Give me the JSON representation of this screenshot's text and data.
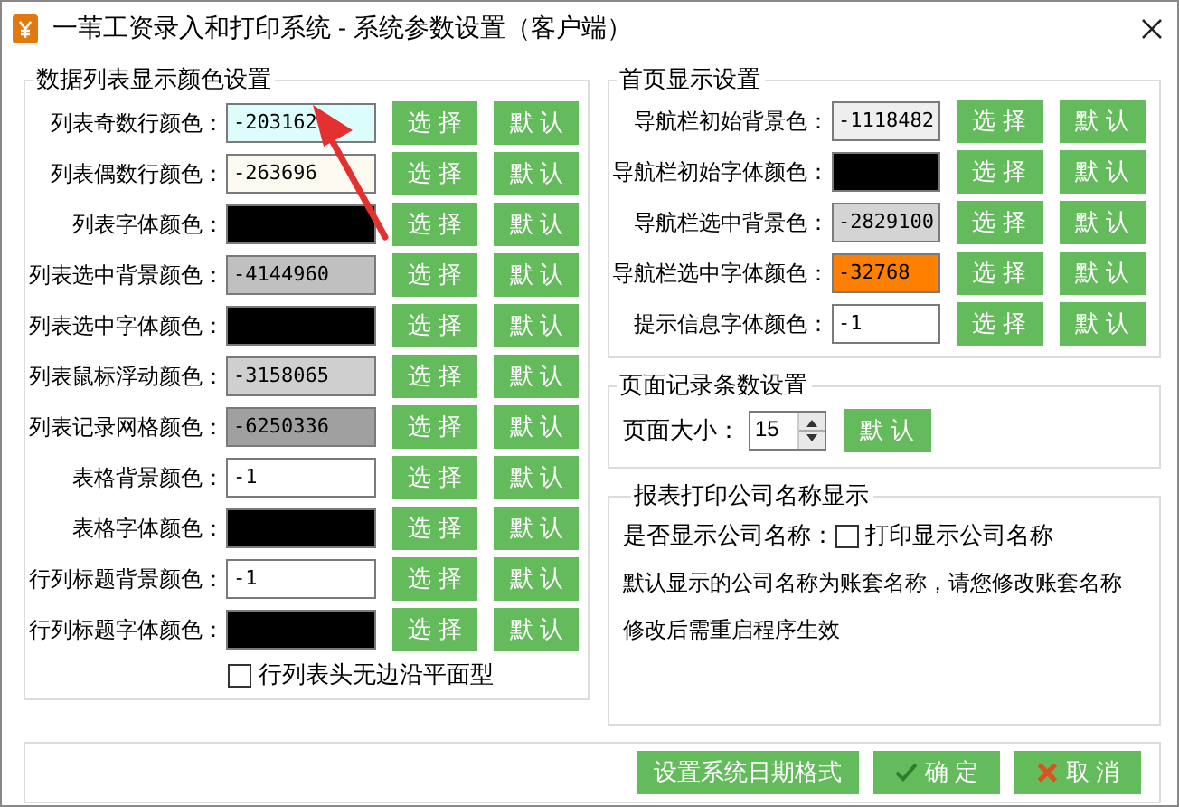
{
  "window": {
    "title": "一苇工资录入和打印系统 - 系统参数设置（客户端）"
  },
  "list_colors": {
    "title": "数据列表显示颜色设置",
    "rows": [
      {
        "label": "列表奇数行颜色：",
        "value": "-203162",
        "color": "#dcfdfb",
        "buttons": [
          "选 择",
          "默 认"
        ]
      },
      {
        "label": "列表偶数行颜色：",
        "value": "-263696",
        "color": "#fbf9f0",
        "buttons": [
          "选 择",
          "默 认"
        ]
      },
      {
        "label": "列表字体颜色：",
        "color": "#000000",
        "buttons": [
          "选 择",
          "默 认"
        ]
      },
      {
        "label": "列表选中背景颜色：",
        "value": "-4144960",
        "color": "#c0c0c0",
        "buttons": [
          "选 择",
          "默 认"
        ]
      },
      {
        "label": "列表选中字体颜色：",
        "color": "#000000",
        "buttons": [
          "选 择",
          "默 认"
        ]
      },
      {
        "label": "列表鼠标浮动颜色：",
        "value": "-3158065",
        "color": "#cfcfcf",
        "buttons": [
          "选 择",
          "默 认"
        ]
      },
      {
        "label": "列表记录网格颜色：",
        "value": "-6250336",
        "color": "#a0a0a0",
        "buttons": [
          "选 择",
          "默 认"
        ]
      },
      {
        "label": "表格背景颜色：",
        "value": "-1",
        "color": "#ffffff",
        "buttons": [
          "选 择",
          "默 认"
        ]
      },
      {
        "label": "表格字体颜色：",
        "color": "#000000",
        "buttons": [
          "选 择",
          "默 认"
        ]
      },
      {
        "label": "行列标题背景颜色：",
        "value": "-1",
        "color": "#ffffff",
        "buttons": [
          "选 择",
          "默 认"
        ]
      },
      {
        "label": "行列标题字体颜色：",
        "color": "#000000",
        "buttons": [
          "选 择",
          "默 认"
        ]
      }
    ],
    "checkbox": {
      "label": "行列表头无边沿平面型",
      "checked": false
    }
  },
  "home_colors": {
    "title": "首页显示设置",
    "rows": [
      {
        "label": "导航栏初始背景色：",
        "value": "-1118482",
        "color": "#eeeeee",
        "buttons": [
          "选 择",
          "默 认"
        ]
      },
      {
        "label": "导航栏初始字体颜色：",
        "color": "#000000",
        "buttons": [
          "选 择",
          "默 认"
        ]
      },
      {
        "label": "导航栏选中背景色：",
        "value": "-2829100",
        "color": "#d4d4d4",
        "buttons": [
          "选 择",
          "默 认"
        ]
      },
      {
        "label": "导航栏选中字体颜色：",
        "value": "-32768",
        "color": "#ff8000",
        "buttons": [
          "选 择",
          "默 认"
        ]
      },
      {
        "label": "提示信息字体颜色：",
        "value": "-1",
        "color": "#ffffff",
        "buttons": [
          "选 择",
          "默 认"
        ]
      }
    ]
  },
  "page_size": {
    "title": "页面记录条数设置",
    "label": "页面大小：",
    "value": "15",
    "button": "默 认"
  },
  "company_name": {
    "title": "报表打印公司名称显示",
    "label": "是否显示公司名称：",
    "checkbox": {
      "label": "打印显示公司名称",
      "checked": false
    },
    "note_lines": [
      "默认显示的公司名称为账套名称，请您修改账套名称",
      "修改后需重启程序生效"
    ]
  },
  "footer_buttons": [
    {
      "kind": "plain",
      "label": "设置系统日期格式"
    },
    {
      "kind": "confirm",
      "label": "确 定"
    },
    {
      "kind": "cancel",
      "label": "取 消"
    }
  ]
}
